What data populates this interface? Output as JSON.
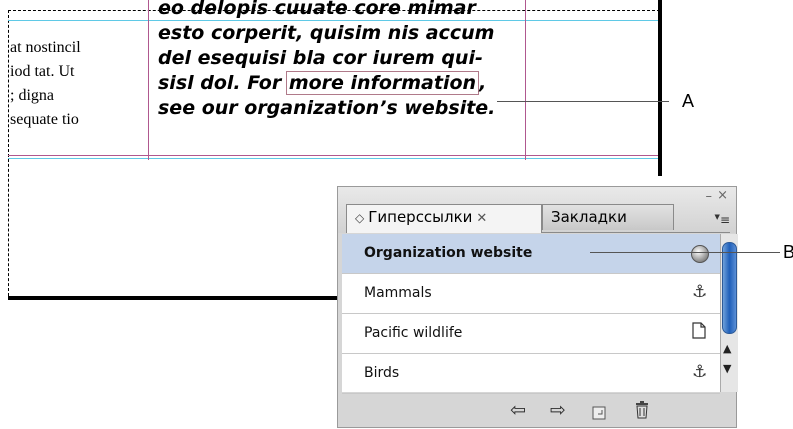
{
  "document": {
    "column1_lines": [
      "at nostincil",
      "iod tat. Ut",
      "; digna",
      "sequate tio"
    ],
    "column2_lines": [
      "eo delopis cuuate core mimar",
      "esto corperit, quisim nis accum",
      "del esequisi bla cor iurem qui-",
      "sisl dol. For ",
      "see our organization’s website."
    ],
    "link_text": "more information",
    "link_after": ","
  },
  "callouts": {
    "a": "A",
    "b": "B"
  },
  "panel": {
    "tabs": [
      {
        "label": "Гиперссылки",
        "active": true
      },
      {
        "label": "Закладки",
        "active": false
      }
    ],
    "window_min": "–",
    "window_close": "×",
    "menu_glyph": "≡",
    "items": [
      {
        "label": "Organization website",
        "icon": "globe-icon",
        "selected": true
      },
      {
        "label": "Mammals",
        "icon": "anchor-icon",
        "selected": false
      },
      {
        "label": "Pacific wildlife",
        "icon": "page-icon",
        "selected": false
      },
      {
        "label": "Birds",
        "icon": "anchor-icon",
        "selected": false
      }
    ],
    "toolbar_icons": [
      "go-to-source-icon",
      "go-to-destination-icon",
      "new-hyperlink-icon",
      "delete-icon"
    ]
  },
  "colors": {
    "selection": "#c5d4ea",
    "scroll_thumb": "#1f5fb9",
    "guide_cyan": "#5fc9e6",
    "guide_magenta": "#b0588f"
  }
}
